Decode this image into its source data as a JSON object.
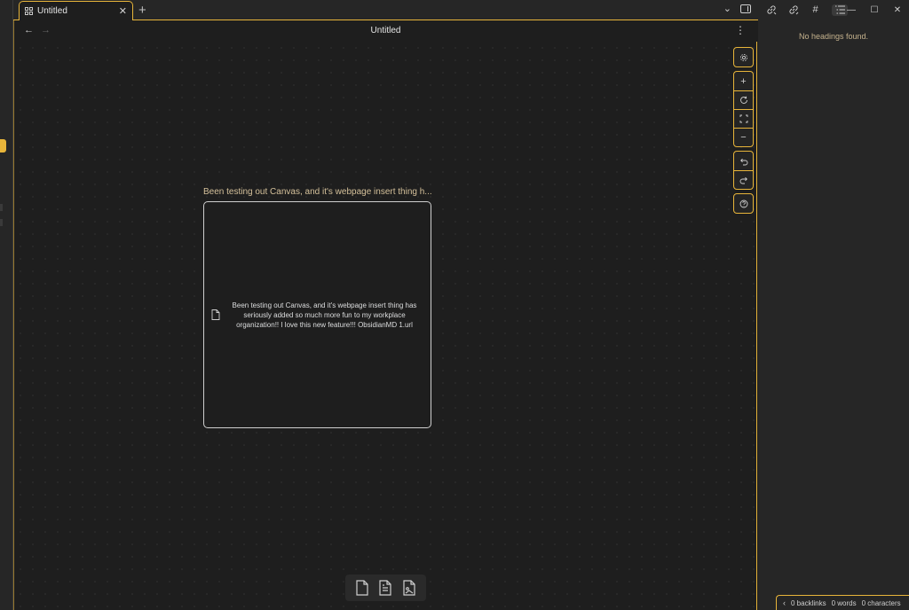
{
  "tab": {
    "title": "Untitled",
    "close": "✕",
    "new_tab": "+"
  },
  "tabbar": {
    "chevron": "⌄"
  },
  "view": {
    "title": "Untitled",
    "back": "←",
    "forward": "→",
    "more": "⋮"
  },
  "node": {
    "label": "Been testing out Canvas, and it's webpage insert thing h...",
    "text": "Been testing out Canvas, and it's webpage insert thing has seriously added so much more fun to my workplace organization!! I love this new feature!!! ObsidianMD 1.url"
  },
  "canvas_controls": {
    "settings": "settings",
    "zoom_in": "+",
    "reset": "reset",
    "fit": "fit",
    "zoom_out": "−",
    "undo": "undo",
    "redo": "redo",
    "help": "?"
  },
  "card_toolbar": [
    "add-note",
    "add-card",
    "add-media"
  ],
  "right_sidebar": {
    "icons": [
      "backlinks-icon",
      "outgoing-links-icon",
      "tags-icon",
      "outline-icon"
    ],
    "tags_glyph": "#",
    "empty_message": "No headings found."
  },
  "window": {
    "minimize": "—",
    "maximize": "☐",
    "close": "✕"
  },
  "status": {
    "chevron": "‹",
    "backlinks": "0 backlinks",
    "words": "0 words",
    "characters": "0 characters"
  },
  "colors": {
    "accent": "#e8b53a",
    "background": "#1e1e1e",
    "panel": "#262626"
  }
}
